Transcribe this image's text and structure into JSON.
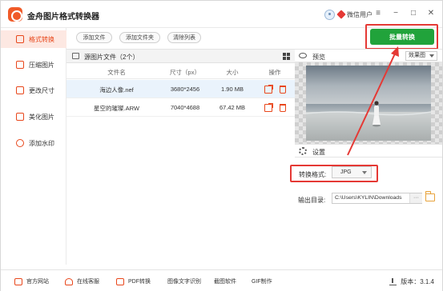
{
  "app": {
    "title": "金舟图片格式转换器",
    "user_name": "微信用户",
    "window_controls": [
      "≡",
      "−",
      "□",
      "✕"
    ]
  },
  "sidebar": {
    "items": [
      {
        "label": "格式转换",
        "icon": "format-convert-icon",
        "active": true
      },
      {
        "label": "压缩图片",
        "icon": "compress-icon",
        "active": false
      },
      {
        "label": "更改尺寸",
        "icon": "resize-icon",
        "active": false
      },
      {
        "label": "美化图片",
        "icon": "beautify-icon",
        "active": false
      },
      {
        "label": "添加水印",
        "icon": "watermark-icon",
        "active": false
      }
    ]
  },
  "toolbar": {
    "add_file": "添加文件",
    "add_folder": "添加文件夹",
    "clear_list": "清除列表",
    "convert": "批量转换"
  },
  "files": {
    "header": "源图片文件（2个）",
    "columns": [
      "文件名",
      "尺寸（px）",
      "大小",
      "操作"
    ],
    "rows": [
      {
        "name": "海边人像.nef",
        "dimensions": "3680*2456",
        "size": "1.90 MB",
        "selected": true
      },
      {
        "name": "星空的璀璨.ARW",
        "dimensions": "7040*4688",
        "size": "67.42 MB",
        "selected": false
      }
    ]
  },
  "preview": {
    "label": "预览",
    "effect_select": "效果图"
  },
  "settings": {
    "label": "设置",
    "format_label": "转换格式:",
    "format_value": "JPG",
    "output_label": "输出目录:",
    "output_path": "C:\\Users\\KYLIN\\Downloads",
    "browse_label": "···"
  },
  "bottom": {
    "items": [
      "官方网站",
      "在线客服",
      "PDF转换",
      "图像文字识别",
      "截图软件",
      "GIF制作"
    ],
    "version": "版本：3.1.4"
  },
  "colors": {
    "accent": "#e8471b",
    "convert_button": "#21a33b",
    "highlight": "#e53935"
  }
}
